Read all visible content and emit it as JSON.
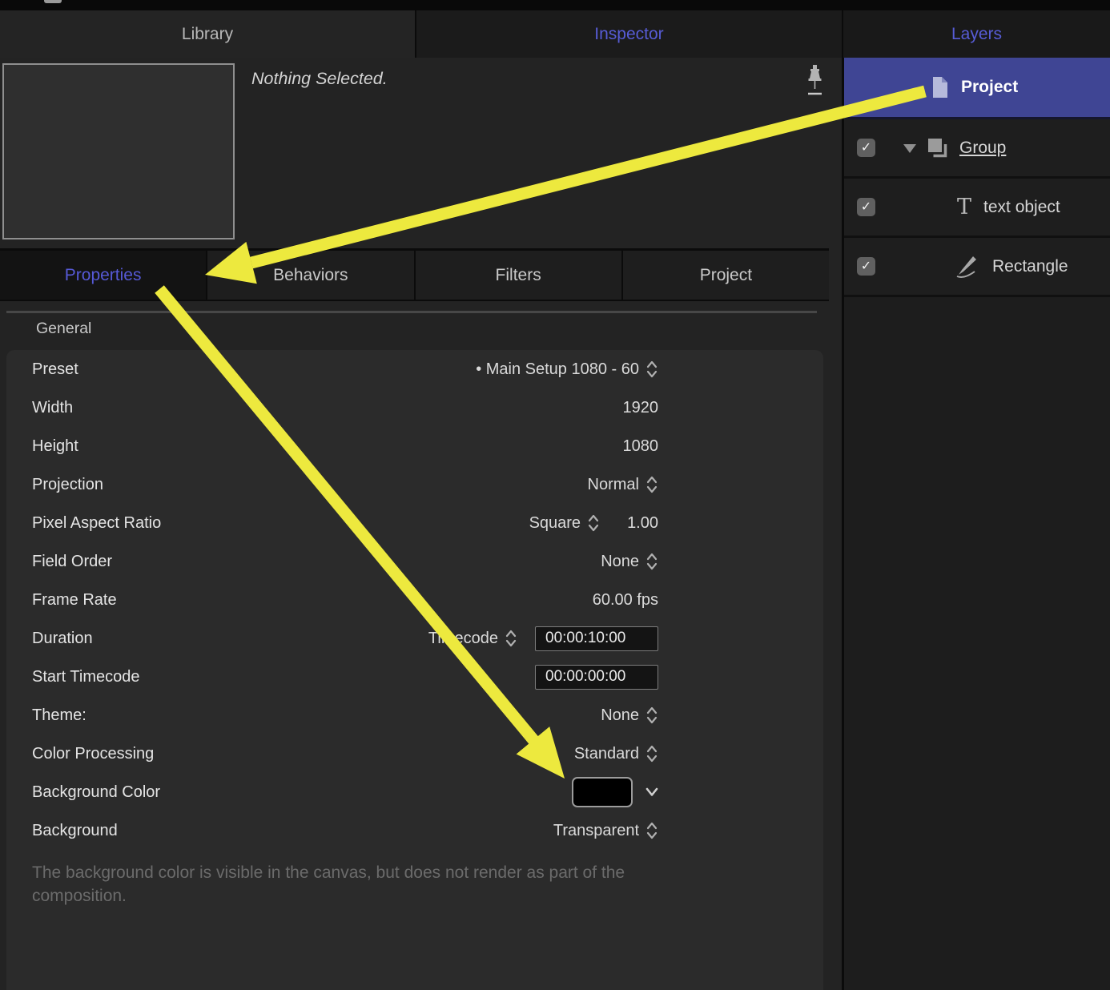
{
  "top_tabs": {
    "library": "Library",
    "inspector": "Inspector",
    "layers": "Layers"
  },
  "inspector": {
    "status_text": "Nothing Selected.",
    "tabs": [
      {
        "label": "Properties",
        "active": true
      },
      {
        "label": "Behaviors",
        "active": false
      },
      {
        "label": "Filters",
        "active": false
      },
      {
        "label": "Project",
        "active": false
      }
    ],
    "section_title": "General",
    "rows": {
      "preset": {
        "label": "Preset",
        "value": "• Main Setup 1080 - 60"
      },
      "width": {
        "label": "Width",
        "value": "1920"
      },
      "height": {
        "label": "Height",
        "value": "1080"
      },
      "projection": {
        "label": "Projection",
        "value": "Normal"
      },
      "pixel_aspect_ratio": {
        "label": "Pixel Aspect Ratio",
        "value": "Square",
        "ratio": "1.00"
      },
      "field_order": {
        "label": "Field Order",
        "value": "None"
      },
      "frame_rate": {
        "label": "Frame Rate",
        "value": "60.00 fps"
      },
      "duration": {
        "label": "Duration",
        "mode": "Timecode",
        "value": "00:00:10:00"
      },
      "start_timecode": {
        "label": "Start Timecode",
        "value": "00:00:00:00"
      },
      "theme": {
        "label": "Theme:",
        "value": "None"
      },
      "color_processing": {
        "label": "Color Processing",
        "value": "Standard"
      },
      "background_color": {
        "label": "Background Color",
        "swatch_color": "#000000"
      },
      "background": {
        "label": "Background",
        "value": "Transparent"
      }
    },
    "note": "The background color is visible in the canvas, but does not render as part of the composition."
  },
  "layers": {
    "project_label": "Project",
    "group_label": "Group",
    "text_object_label": "text object",
    "rectangle_label": "Rectangle",
    "text_icon_glyph": "T"
  },
  "colors": {
    "accent_purple": "#575cd6",
    "selection_blue": "#3f4594",
    "arrow_yellow": "#ede93e",
    "swatch_black": "#000000"
  }
}
